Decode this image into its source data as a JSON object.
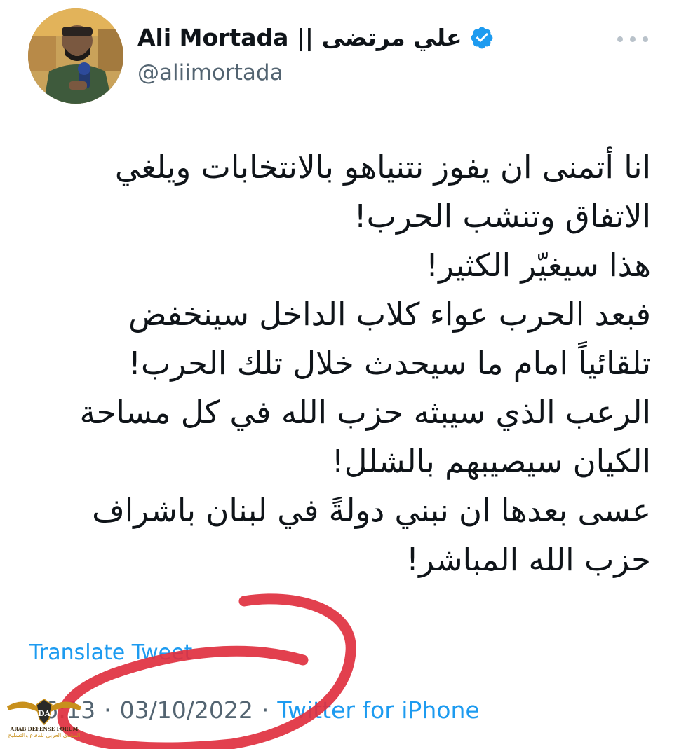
{
  "author": {
    "display_name": "Ali Mortada || علي مرتضى",
    "handle": "@aliimortada",
    "verified": true
  },
  "tweet": {
    "lines": [
      "انا أتمنى ان يفوز نتنياهو بالانتخابات ويلغي",
      "الاتفاق وتنشب الحرب!",
      "هذا سيغيّر الكثير!",
      "فبعد الحرب عواء كلاب الداخل سينخفض",
      "تلقائياً امام ما سيحدث خلال تلك الحرب!",
      "الرعب الذي سيبثه حزب الله في كل مساحة",
      "الكيان سيصيبهم بالشلل!",
      "عسى بعدها ان نبني دولةً في لبنان باشراف",
      "حزب الله المباشر!"
    ]
  },
  "translate_label": "Translate Tweet",
  "meta": {
    "time": "6:13",
    "separator": "·",
    "date": "03/10/2022",
    "source": "Twitter for iPhone"
  },
  "watermark": {
    "logo_text": "DA",
    "name_en": "ARAB DEFENSE FORUM",
    "name_ar": "المنتدى العربي للدفاع والتسليح"
  },
  "colors": {
    "link": "#1d9bf0",
    "secondary_text": "#536471",
    "primary_text": "#0f1419",
    "verified": "#1d9bf0",
    "annotation": "#e0303f"
  },
  "icons": {
    "verified": "verified-badge-icon",
    "more": "more-dots-icon"
  }
}
